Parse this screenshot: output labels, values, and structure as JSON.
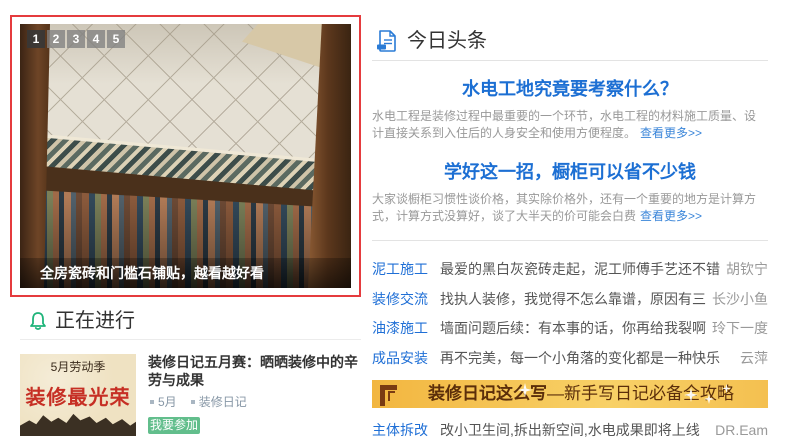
{
  "slider": {
    "numbers": [
      "1",
      "2",
      "3",
      "4",
      "5"
    ],
    "active_slide": 1,
    "caption": "全房瓷砖和门槛石铺贴，越看越好看"
  },
  "ongoing": {
    "title": "正在进行",
    "card": {
      "thumb_line1": "5月劳动季",
      "thumb_line2": "装修最光荣",
      "title": "装修日记五月赛：晒晒装修中的辛劳与成果",
      "tags": [
        "5月",
        "装修日记"
      ],
      "join_label": "我要参加"
    }
  },
  "top_news": {
    "title": "今日头条",
    "headlines": [
      {
        "title": "水电工地究竟要考察什么？",
        "summary": "水电工程是装修过程中最重要的一个环节，水电工程的材料施工质量、设计直接关系到入住后的人身安全和使用方便程度。",
        "more": "查看更多>>"
      },
      {
        "title": "学好这一招，橱柜可以省不少钱",
        "summary": "大家谈橱柜习惯性谈价格，其实除价格外，还有一个重要的地方是计算方式，计算方式没算好，谈了大半天的价可能会白费",
        "more": "查看更多>>"
      }
    ],
    "list": [
      {
        "category": "泥工施工",
        "title": "最爱的黑白灰瓷砖走起，泥工师傅手艺还不错",
        "author": "胡钦宁"
      },
      {
        "category": "装修交流",
        "title": "找执人装修，我觉得不怎么靠谱，原因有三",
        "author": "长沙小鱼"
      },
      {
        "category": "油漆施工",
        "title": "墙面问题后续：有本事的话，你再给我裂啊",
        "author": "玲下一度"
      },
      {
        "category": "成品安装",
        "title": "再不完美，每一个小角落的变化都是一种快乐",
        "author": "云萍"
      }
    ],
    "banner": {
      "title": "装修日记这么写",
      "subtitle": "—新手写日记必备全攻略"
    },
    "more_list": [
      {
        "category": "主体拆改",
        "title": "改小卫生间,拆出新空间,水电成果即将上线",
        "author": "DR.Eam"
      }
    ]
  },
  "icons": {
    "news_header": "document-icon",
    "ongoing_header": "bell-icon"
  },
  "colors": {
    "slider_border": "#e53b3e",
    "headline_blue": "#1c6fd3",
    "category_blue": "#1f6fd6",
    "accent_green": "#1fb47a",
    "join_button_green": "#62be8c",
    "banner_yellow": "#f2b640"
  }
}
